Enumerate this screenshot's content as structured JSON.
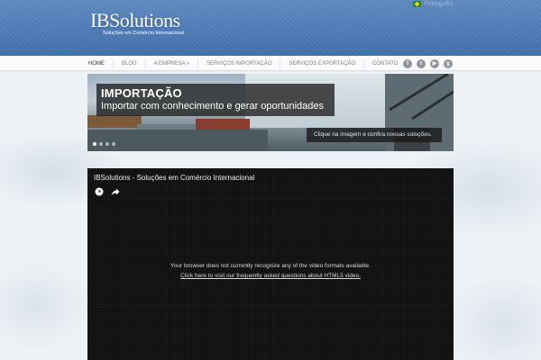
{
  "header": {
    "logo_title": "IBSolutions",
    "logo_subtitle": "Soluções em Comércio Internacional",
    "language_label": "Português"
  },
  "nav": {
    "items": [
      {
        "label": "HOME"
      },
      {
        "label": "BLOG"
      },
      {
        "label": "A EMPRESA »"
      },
      {
        "label": "SERVIÇOS IMPORTAÇÃO"
      },
      {
        "label": "SERVIÇOS EXPORTAÇÃO"
      },
      {
        "label": "CONTATO"
      }
    ],
    "active": "HOME",
    "social_icons": [
      "facebook-icon",
      "twitter-icon",
      "youtube-icon",
      "google-plus-icon"
    ]
  },
  "slider": {
    "title": "IMPORTAÇÃO",
    "subtitle": "Importar com conhecimento e gerar oportunidades",
    "click_text": "Clique na imagem e confira nossas soluções.",
    "slide_count": 4,
    "active_slide": 1
  },
  "video": {
    "title": "IBSolutions - Soluções em Comércio Internacional",
    "message": "Your browser does not currently recognize any of the video formats available.",
    "link": "Click here to visit our frequently asked questions about HTML5 video."
  },
  "colors": {
    "header_blue": "#4a78b3",
    "video_bg": "#111111"
  }
}
